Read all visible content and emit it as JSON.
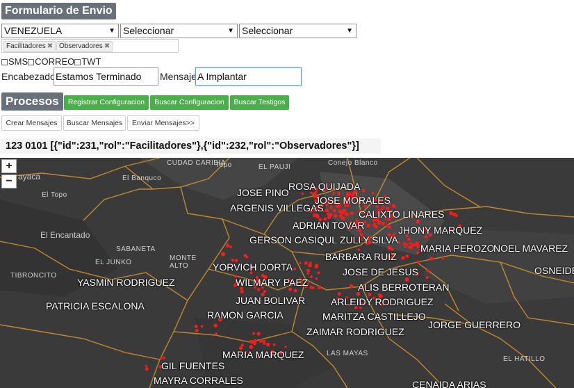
{
  "header": {
    "title": "Formulario de Envio"
  },
  "selects": [
    {
      "value": "VENEZUELA"
    },
    {
      "value": "Seleccionar"
    },
    {
      "value": "Seleccionar"
    }
  ],
  "tags": [
    {
      "label": "Facilitadores"
    },
    {
      "label": "Observadores"
    }
  ],
  "channels": [
    "SMS",
    "CORREO",
    "TWT"
  ],
  "form": {
    "header_label": "Encabezado:",
    "header_value": "Estamos Terminado",
    "message_label": "Mensaje:",
    "message_value": "A Implantar"
  },
  "procesos": {
    "title": "Procesos",
    "buttons": [
      "Registrar Configuracion",
      "Buscar Configuracion",
      "Buscar Testigos"
    ]
  },
  "actions": [
    "Crear Mensajes",
    "Buscar Mensajes",
    "Enviar Mensajes>>"
  ],
  "status": "123 0101 [{\"id\":231,\"rol\":\"Facilitadores\"},{\"id\":232,\"rol\":\"Observadores\"}]",
  "map": {
    "zoom_in": "+",
    "zoom_out": "−",
    "places": [
      "CUDAD CARIBIA",
      "Topo",
      "EL PAUJI",
      "Conejo Blanco",
      "ayaca",
      "El Banquco",
      "El Topo",
      "El Encantado",
      "SABANETA",
      "EL JUNKO",
      "MONTE ALTO",
      "TIBRONCITO",
      "LAS MAYAS",
      "EL HATILLO"
    ],
    "markers": [
      "ROSA QUIJADA",
      "JOSE PINO",
      "JOSE MORALES",
      "ARGENIS VILLEGAS",
      "CALIXTO LINARES",
      "ADRIAN TOVAR",
      "JHONY MARQUEZ",
      "GERSON CASIQUL",
      "ZULLY SILVA",
      "MARIA PEROZO",
      "NOEL MAVAREZ",
      "BARBARA RUIZ",
      "YORVICH DORTA",
      "OSNEIDE",
      "JOSE DE JESUS",
      "YASMIN RODRIGUEZ",
      "WILMARY PAEZ",
      "ALIS BERROTERAN",
      "JUAN BOLIVAR",
      "PATRICIA ESCALONA",
      "ARLEIDY RODRIGUEZ",
      "RAMON GARCIA",
      "MARITZA CASTILLEJO",
      "JORGE GUERRERO",
      "ZAIMAR RODRIGUEZ",
      "MARIA MARQUEZ",
      "GIL FUENTES",
      "MAYRA CORRALES",
      "CENAIDA ARIAS"
    ],
    "point_color": "#ff1a1a",
    "road_color": "#d8972e"
  }
}
